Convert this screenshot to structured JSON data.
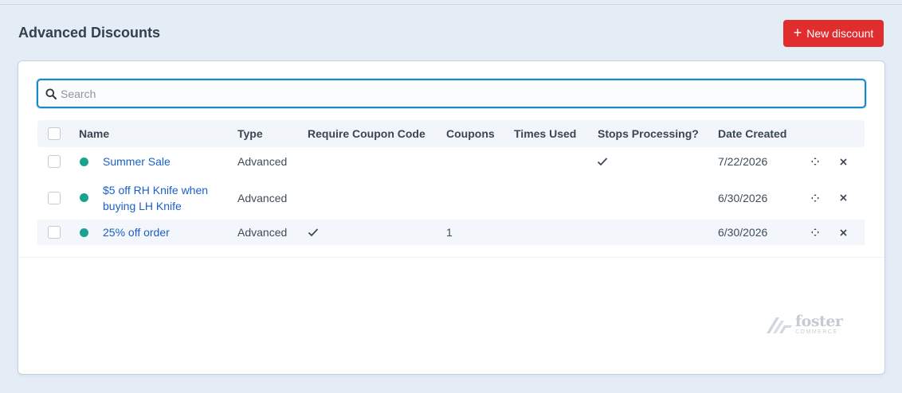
{
  "header": {
    "title": "Advanced Discounts",
    "new_button_label": "New discount",
    "new_button_icon": "plus-icon"
  },
  "search": {
    "value": "",
    "placeholder": "Search",
    "icon": "search-icon"
  },
  "table": {
    "columns": [
      "Name",
      "Type",
      "Require Coupon Code",
      "Coupons",
      "Times Used",
      "Stops Processing?",
      "Date Created"
    ],
    "rows": [
      {
        "status_color": "#18a28f",
        "name": "Summer Sale",
        "type": "Advanced",
        "require_coupon_code": false,
        "coupons": "",
        "times_used": "",
        "stops_processing": true,
        "date_created": "7/22/2026"
      },
      {
        "status_color": "#18a28f",
        "name": "$5 off RH Knife when buying LH Knife",
        "type": "Advanced",
        "require_coupon_code": false,
        "coupons": "",
        "times_used": "",
        "stops_processing": false,
        "date_created": "6/30/2026"
      },
      {
        "status_color": "#18a28f",
        "name": "25% off order",
        "type": "Advanced",
        "require_coupon_code": true,
        "coupons": "1",
        "times_used": "",
        "stops_processing": false,
        "date_created": "6/30/2026"
      }
    ],
    "row_actions": [
      "move-icon",
      "delete-icon"
    ]
  },
  "logo": {
    "text": "foster",
    "subtext": "COMMERCE"
  },
  "colors": {
    "accent": "#e12d2d",
    "link": "#1c5fc7",
    "focus": "#1b8ac4",
    "status_enabled": "#18a28f"
  }
}
